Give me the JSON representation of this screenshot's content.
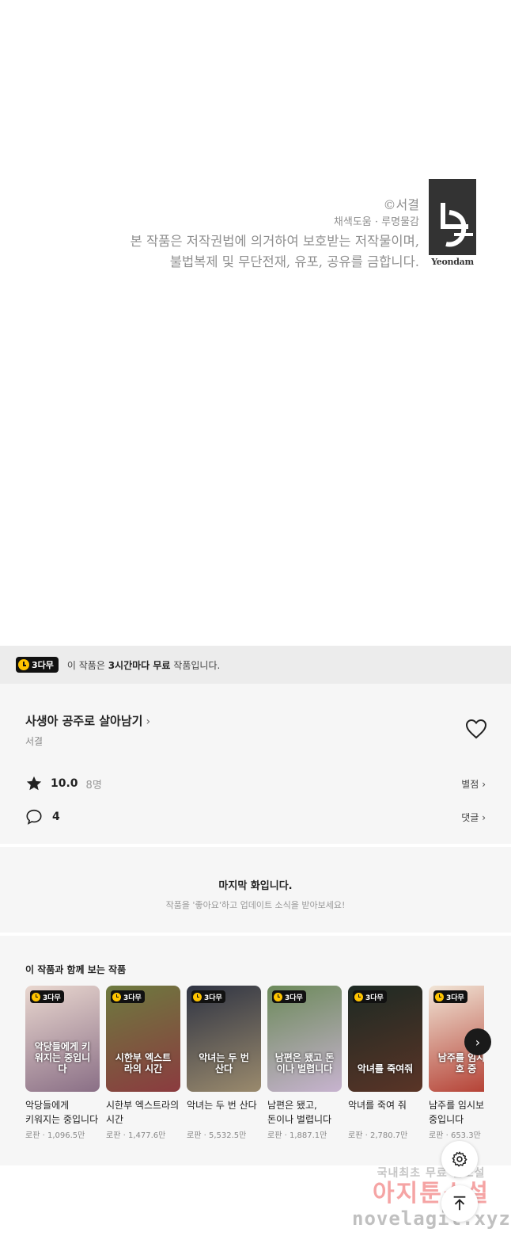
{
  "copyright": {
    "author_line": "©서결",
    "credits_line": "채색도움 · 루명물감",
    "notice_line1": "본 작품은 저작권법에 의거하여 보호받는 저작물이며,",
    "notice_line2": "불법복제 및 무단전재, 유포, 공유를 금합니다.",
    "logo_text": "Yeondam"
  },
  "free_banner": {
    "badge": "3다무",
    "text_pre": "이 작품은 ",
    "text_bold": "3시간마다 무료",
    "text_post": " 작품입니다."
  },
  "work": {
    "title": "사생아 공주로 살아남기",
    "author": "서결",
    "rating": "10.0",
    "rating_count": "8명",
    "rating_link": "별점",
    "comments": "4",
    "comments_link": "댓글"
  },
  "last_episode": {
    "title": "마지막 화입니다.",
    "subtitle": "작품을 '좋아요'하고 업데이트 소식을 받아보세요!"
  },
  "recommendations": {
    "heading": "이 작품과 함께 보는 작품",
    "items": [
      {
        "badge": "3다무",
        "name": "악당들에게 키워지는 중입니다",
        "genre": "로판",
        "views": "1,096.5만",
        "cover_text": "악당들에게 키워지는 중입니다",
        "color1": "#e9d7cf",
        "color2": "#8a6f86"
      },
      {
        "badge": "3다무",
        "name": "시한부 엑스트라의 시간",
        "genre": "로판",
        "views": "1,477.6만",
        "cover_text": "시한부 엑스트라의 시간",
        "color1": "#6d7a3f",
        "color2": "#8b3b3f"
      },
      {
        "badge": "3다무",
        "name": "악녀는 두 번 산다",
        "genre": "로판",
        "views": "5,532.5만",
        "cover_text": "악녀는 두 번 산다",
        "color1": "#2f3443",
        "color2": "#9a8a6d"
      },
      {
        "badge": "3다무",
        "name": "남편은 됐고, 돈이나 벌렵니다",
        "genre": "로판",
        "views": "1,887.1만",
        "cover_text": "남편은 됐고 돈이나 벌렵니다",
        "color1": "#6c8a5a",
        "color2": "#c7b3cf"
      },
      {
        "badge": "3다무",
        "name": "악녀를 죽여 줘",
        "genre": "로판",
        "views": "2,780.7만",
        "cover_text": "악녀를 죽여줘",
        "color1": "#1d2a24",
        "color2": "#5a3426"
      },
      {
        "badge": "3다무",
        "name": "남주를 임시보호 중입니다",
        "genre": "로판",
        "views": "653.3만",
        "cover_text": "남주를 임시보호 중",
        "color1": "#f1e5d6",
        "color2": "#b23a2e"
      }
    ]
  },
  "watermark": {
    "line1": "국내최초 무료 웹소설",
    "line2": "아지툰소설",
    "line3": "novelagit.xyz"
  }
}
